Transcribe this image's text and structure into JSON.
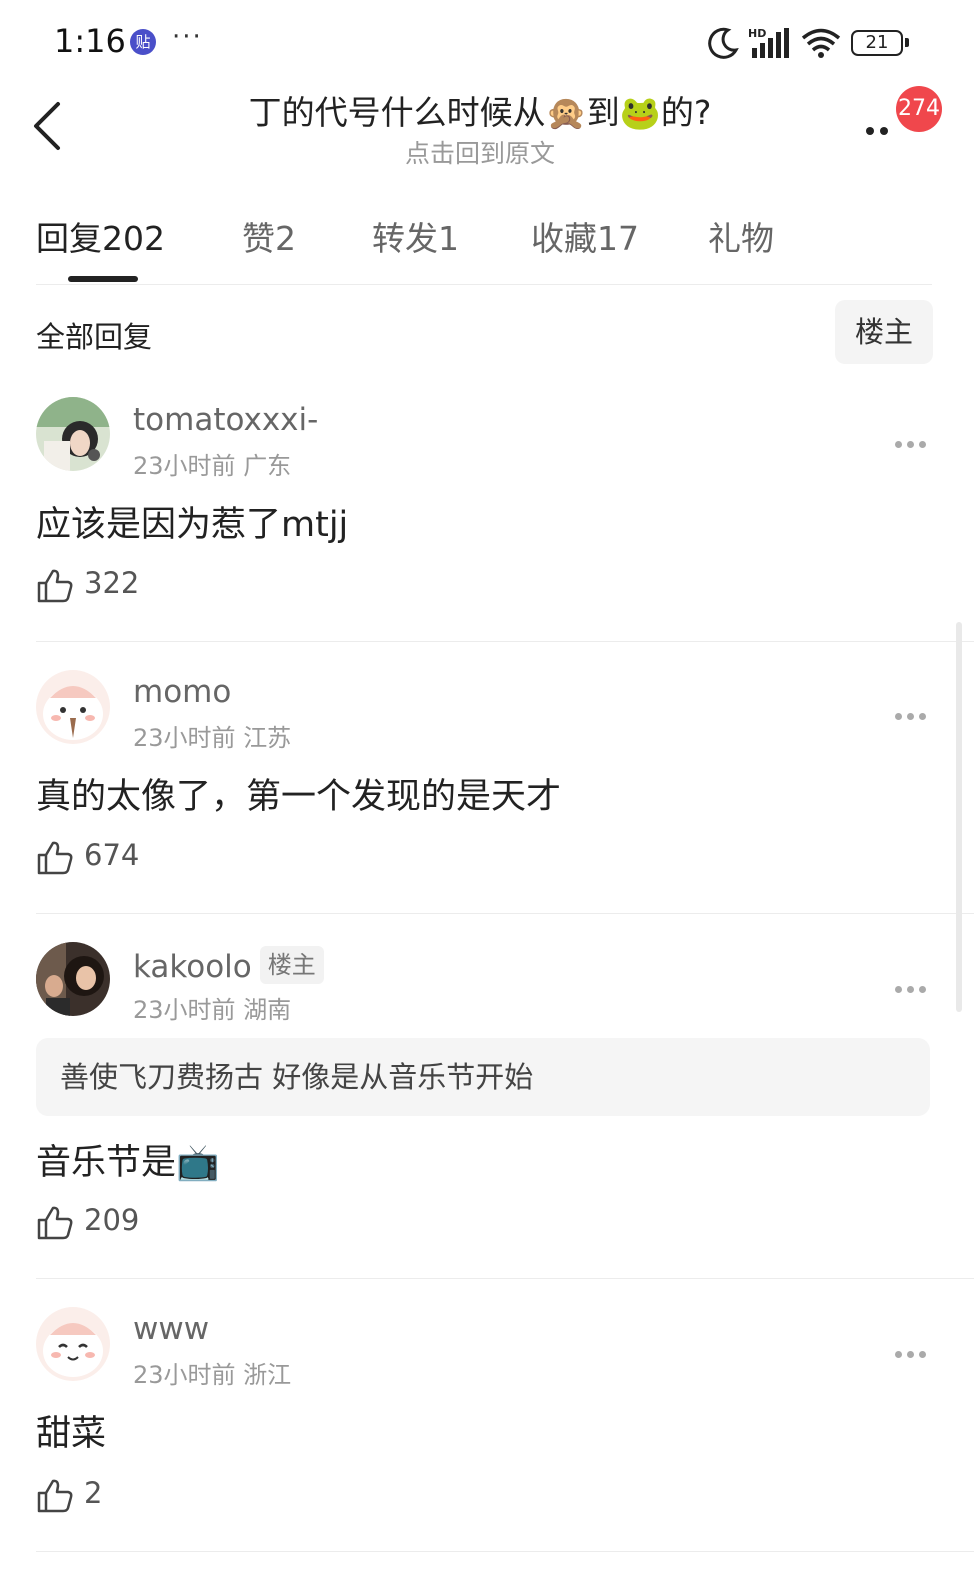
{
  "status_bar": {
    "time": "1:16",
    "app_icon_text": "贴",
    "more": "···",
    "battery": "21",
    "icons": [
      "moon-icon",
      "hd-signal-icon",
      "wifi-icon",
      "battery-icon"
    ]
  },
  "header": {
    "title": "丁的代号什么时候从🙊到🐸的?",
    "subtitle": "点击回到原文",
    "notification_count": "274"
  },
  "tabs": [
    {
      "label": "回复",
      "count": "202"
    },
    {
      "label": "赞",
      "count": "2"
    },
    {
      "label": "转发",
      "count": "1"
    },
    {
      "label": "收藏",
      "count": "17"
    },
    {
      "label": "礼物",
      "count": ""
    }
  ],
  "section": {
    "title": "全部回复",
    "filter_label": "楼主"
  },
  "comments": [
    {
      "username": "tomatoxxxi-",
      "time": "23小时前",
      "location": "广东",
      "content": "应该是因为惹了mtjj",
      "likes": "322"
    },
    {
      "username": "momo",
      "time": "23小时前",
      "location": "江苏",
      "content": "真的太像了，第一个发现的是天才",
      "likes": "674"
    },
    {
      "username": "kakoolo",
      "op_badge": "楼主",
      "time": "23小时前",
      "location": "湖南",
      "quote": "善使飞刀费扬古 好像是从音乐节开始",
      "content": "音乐节是📺",
      "likes": "209"
    },
    {
      "username": "www",
      "time": "23小时前",
      "location": "浙江",
      "content": "甜菜",
      "likes": "2"
    }
  ],
  "colors": {
    "badge": "#f0474c",
    "text_primary": "#222222",
    "text_secondary": "#999999"
  }
}
